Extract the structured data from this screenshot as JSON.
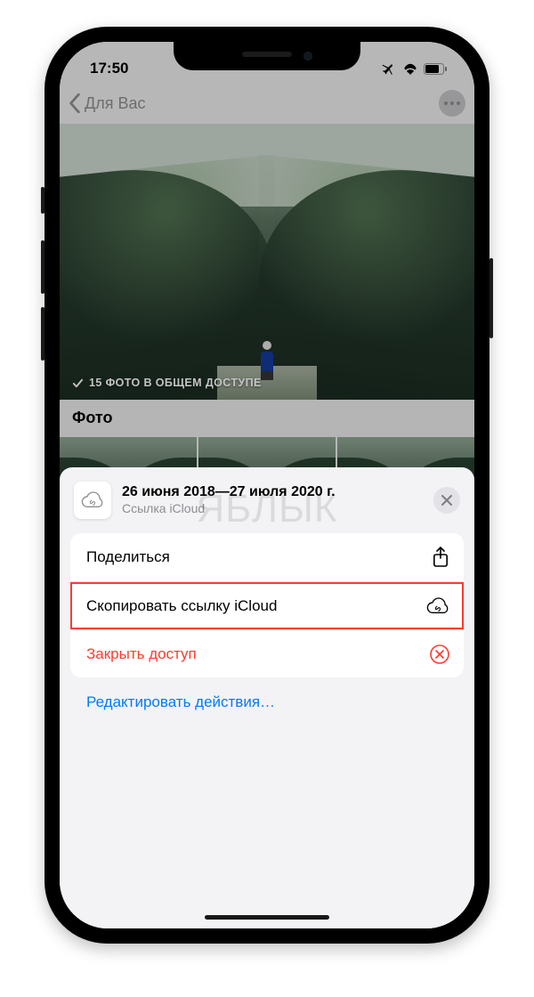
{
  "status": {
    "time": "17:50"
  },
  "nav": {
    "back_label": "Для Вас"
  },
  "hero": {
    "title": "26 июня 2018—27 июля 2020 г.",
    "shared_footer": "15 ФОТО В ОБЩЕМ ДОСТУПЕ"
  },
  "section": {
    "photos_header": "Фото"
  },
  "sheet": {
    "title": "26 июня 2018—27 июля 2020 г.",
    "subtitle": "Ссылка iCloud",
    "actions": {
      "share": "Поделиться",
      "copy_link": "Скопировать ссылку iCloud",
      "close_access": "Закрыть доступ"
    },
    "edit_actions": "Редактировать действия…"
  },
  "watermark": "ЯБЛЫК"
}
